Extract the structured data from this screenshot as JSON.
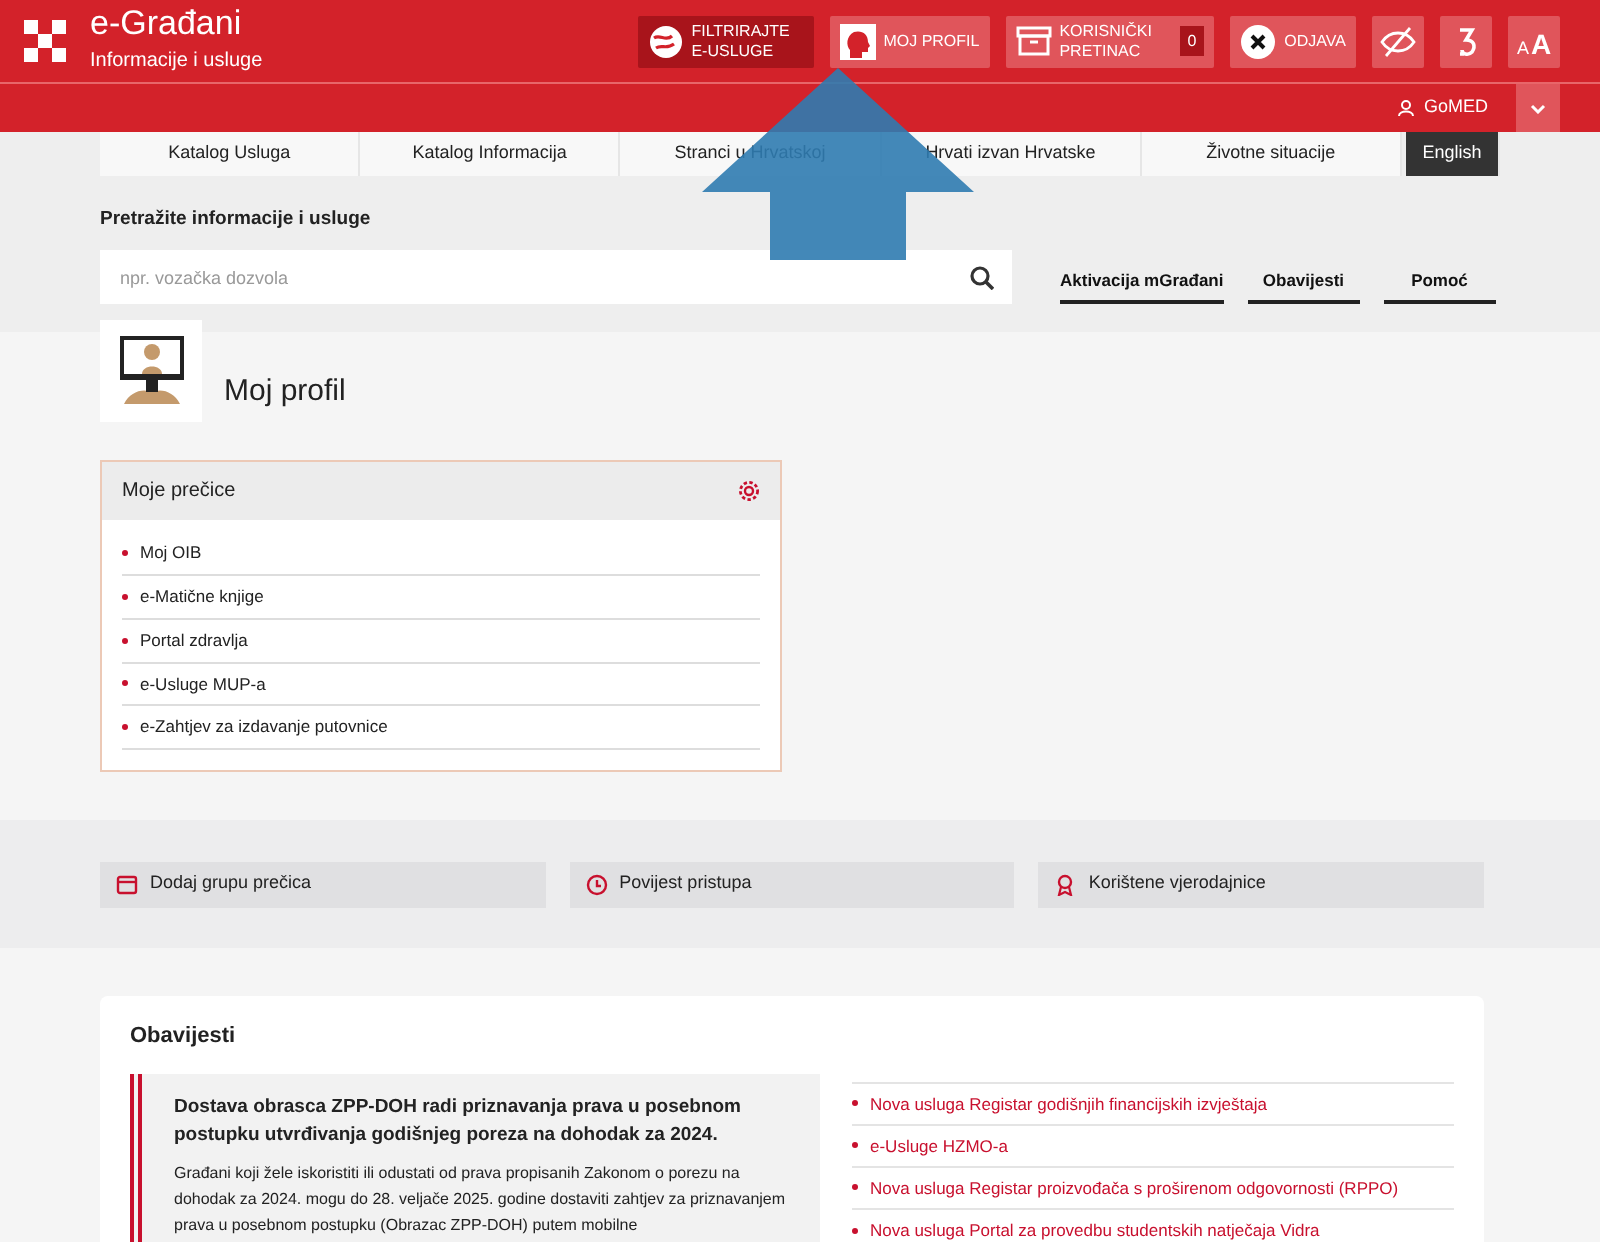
{
  "header": {
    "title": "e-Građani",
    "subtitle": "Informacije i usluge",
    "buttons": [
      {
        "kind": "filter",
        "label": "FILTRIRAJTE E-USLUGE",
        "selected": true
      },
      {
        "kind": "profile",
        "label": "MOJ PROFIL",
        "selected": false
      },
      {
        "kind": "inbox",
        "label": "KORISNIČKI PRETINAC",
        "count": "0",
        "selected": false
      },
      {
        "kind": "logout",
        "label": "ODJAVA",
        "selected": false
      },
      {
        "kind": "contrast",
        "selected": false
      },
      {
        "kind": "dyslexia",
        "selected": false
      },
      {
        "kind": "textsize",
        "small": "A",
        "large": "A",
        "selected": false
      }
    ]
  },
  "user": {
    "name": "GoMED"
  },
  "nav": [
    {
      "label": "Katalog Usluga",
      "kind": "tab"
    },
    {
      "label": "Katalog Informacija",
      "kind": "tab"
    },
    {
      "label": "Stranci u Hrvatskoj",
      "kind": "tab"
    },
    {
      "label": "Hrvati izvan Hrvatske",
      "kind": "tab"
    },
    {
      "label": "Životne situacije",
      "kind": "tab"
    },
    {
      "label": "English",
      "kind": "language"
    }
  ],
  "search": {
    "label": "Pretražite informacije i usluge",
    "placeholder": "npr. vozačka dozvola"
  },
  "quick_links": [
    "Aktivacija mGrađani",
    "Obavijesti",
    "Pomoć"
  ],
  "profile": {
    "title": "Moj profil"
  },
  "shortcuts": {
    "title": "Moje prečice",
    "items": [
      "Moj OIB",
      "e-Matične knjige",
      "Portal zdravlja",
      "e-Usluge MUP-a",
      "e-Zahtjev za izdavanje putovnice"
    ]
  },
  "actions": [
    {
      "kind": "calendar",
      "label": "Dodaj grupu prečica"
    },
    {
      "kind": "clock",
      "label": "Povijest pristupa"
    },
    {
      "kind": "award",
      "label": "Korištene vjerodajnice"
    }
  ],
  "notices": {
    "title": "Obavijesti",
    "featured": {
      "title": "Dostava obrasca ZPP-DOH radi priznavanja prava u posebnom postupku utvrđivanja godišnjeg poreza na dohodak za 2024.",
      "body": "Građani koji žele iskoristiti ili odustati od prava propisanih Zakonom o porezu na dohodak za 2024. mogu do 28. veljače 2025. godine dostaviti zahtjev za priznavanjem prava u posebnom postupku (Obrazac ZPP-DOH) putem mobilne"
    },
    "links": [
      "Nova usluga Registar godišnjih financijskih izvještaja",
      "e-Usluge HZMO-a",
      "Nova usluga Registar proizvođača s proširenom odgovornosti (RPPO)",
      "Nova usluga Portal za provedbu studentskih natječaja Vidra"
    ]
  }
}
